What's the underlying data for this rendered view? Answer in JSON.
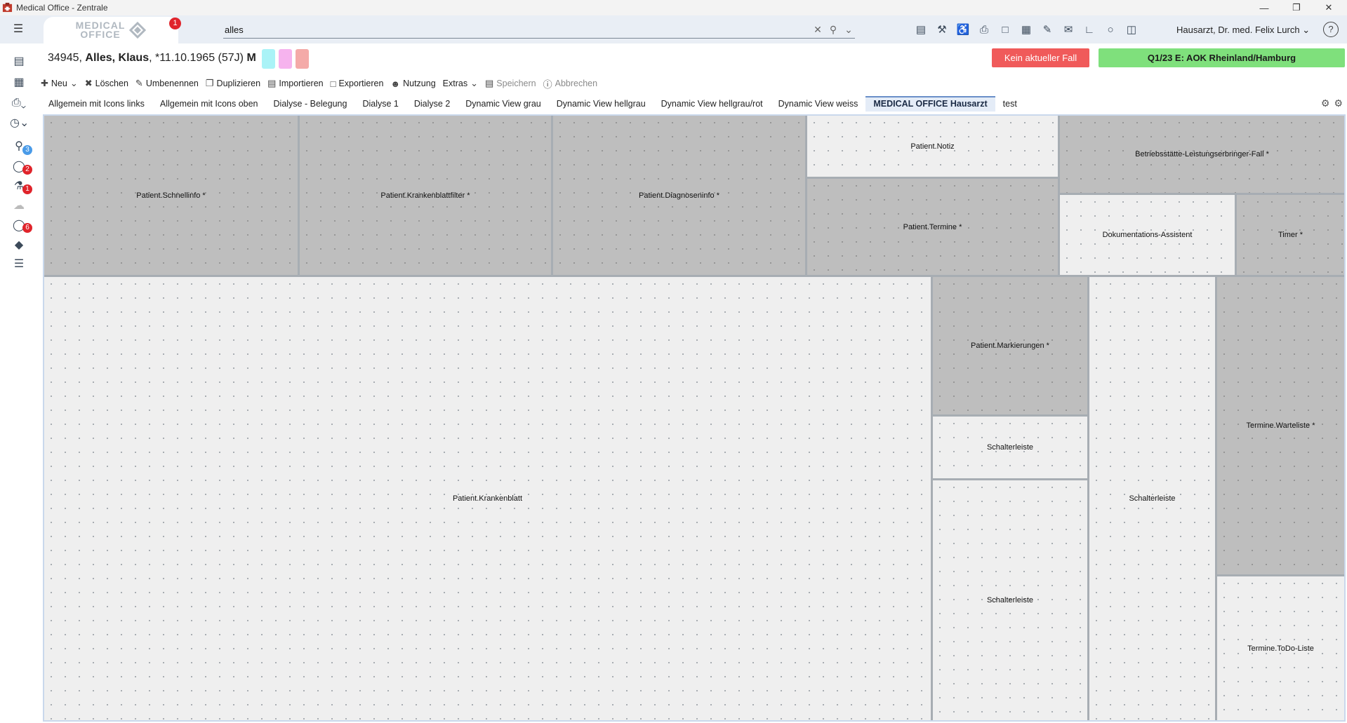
{
  "window": {
    "title": "Medical Office - Zentrale"
  },
  "header": {
    "logo_line1": "MEDICAL",
    "logo_line2": "OFFICE",
    "logo_badge": "1",
    "search_value": "alles",
    "user": "Hausarzt, Dr. med. Felix Lurch",
    "help": "?"
  },
  "sidebar": {
    "badges": [
      "3",
      "2",
      "1",
      "6"
    ]
  },
  "patient": {
    "id": "34945,",
    "name": "Alles, Klaus",
    "dob": ", *11.10.1965 (57J)",
    "sex": "M",
    "fall_button": "Kein aktueller Fall",
    "kasse_button": "Q1/23 E: AOK Rheinland/Hamburg"
  },
  "toolbar": {
    "neu": "Neu",
    "loeschen": "Löschen",
    "umbenennen": "Umbenennen",
    "duplizieren": "Duplizieren",
    "importieren": "Importieren",
    "exportieren": "Exportieren",
    "nutzung": "Nutzung",
    "extras": "Extras",
    "speichern": "Speichern",
    "abbrechen": "Abbrechen"
  },
  "tabs": [
    "Allgemein mit Icons links",
    "Allgemein mit Icons oben",
    "Dialyse - Belegung",
    "Dialyse 1",
    "Dialyse 2",
    "Dynamic View grau",
    "Dynamic View hellgrau",
    "Dynamic View hellgrau/rot",
    "Dynamic View weiss",
    "MEDICAL OFFICE Hausarzt",
    "test"
  ],
  "active_tab": "MEDICAL OFFICE Hausarzt",
  "panels": {
    "schnellinfo": "Patient.Schnellinfo *",
    "krankenblattfilter": "Patient.Krankenblattfilter *",
    "diagnoseninfo": "Patient.Diagnoseninfo *",
    "notiz": "Patient.Notiz",
    "termine": "Patient.Termine *",
    "betriebsstaette": "Betriebsstätte-Leistungserbringer-Fall *",
    "doku_assistent": "Dokumentations-Assistent",
    "timer": "Timer *",
    "krankenblatt": "Patient.Krankenblatt",
    "markierungen": "Patient.Markierungen *",
    "schalterleiste_1": "Schalterleiste",
    "schalterleiste_2": "Schalterleiste",
    "schalterleiste_3": "Schalterleiste",
    "warteliste": "Termine.Warteliste *",
    "todo": "Termine.ToDo-Liste"
  },
  "colors": {
    "fall_button": "#f05a5a",
    "kasse_button": "#7fe07c",
    "badge": "#e0242b",
    "badge_blue": "#4a9be8",
    "swatch_cyan": "#aaf3f7",
    "swatch_pink": "#f6b3ee",
    "swatch_red": "#f4aaa8"
  }
}
